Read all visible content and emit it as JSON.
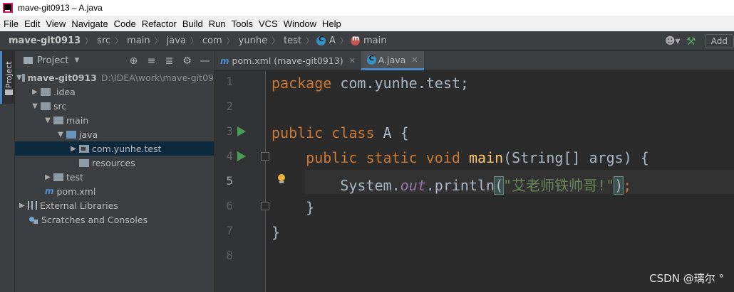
{
  "window": {
    "title": "mave-git0913 – A.java"
  },
  "menu": [
    "File",
    "Edit",
    "View",
    "Navigate",
    "Code",
    "Refactor",
    "Build",
    "Run",
    "Tools",
    "VCS",
    "Window",
    "Help"
  ],
  "breadcrumb": [
    "mave-git0913",
    "src",
    "main",
    "java",
    "com",
    "yunhe",
    "test",
    "A",
    "main"
  ],
  "navbar_right": {
    "add_config_label": "Add"
  },
  "stripe": {
    "project_tab": "Project"
  },
  "project_panel": {
    "title": "Project",
    "tools": [
      "crosshair-icon",
      "collapse-icon",
      "expand-icon",
      "gear-icon",
      "minimize-icon"
    ],
    "tree": {
      "root_name": "mave-git0913",
      "root_path": "D:\\IDEA\\work\\mave-git09",
      "idea": ".idea",
      "src": "src",
      "main": "main",
      "java": "java",
      "package": "com.yunhe.test",
      "resources": "resources",
      "test": "test",
      "pom": "pom.xml",
      "libs": "External Libraries",
      "scratches": "Scratches and Consoles"
    }
  },
  "tabs": [
    {
      "label": "pom.xml (mave-git0913)",
      "active": false
    },
    {
      "label": "A.java",
      "active": true
    }
  ],
  "editor": {
    "line_numbers": [
      "1",
      "2",
      "3",
      "4",
      "5",
      "6",
      "7",
      "8"
    ],
    "current_line": "5",
    "code": {
      "l1_kw": "package",
      "l1_rest": " com.yunhe.test;",
      "l3_kw": "public class",
      "l3_rest": " A {",
      "l4_indent": "    ",
      "l4_kw": "public static void",
      "l4_sp": " ",
      "l4_fn": "main",
      "l4_rest": "(String[] args) {",
      "l5_pre": "        System.",
      "l5_fld": "out",
      "l5_mid": ".println",
      "l5_open": "(",
      "l5_str": "\"艾老师铁帅哥!\"",
      "l5_close": ")",
      "l5_semi": ";",
      "l6": "    }",
      "l7": "}"
    }
  },
  "watermark": "CSDN @璃尔 °"
}
